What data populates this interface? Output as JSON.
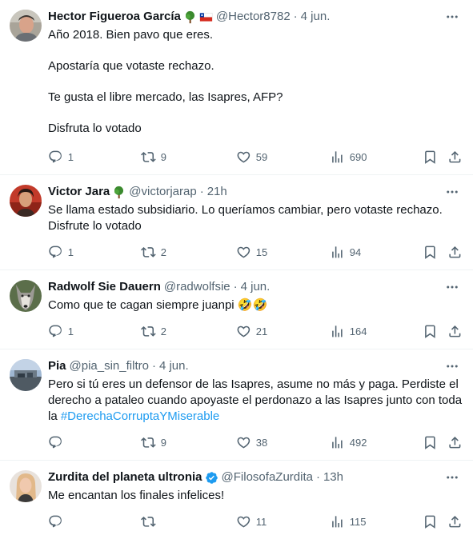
{
  "tweets": [
    {
      "name": "Hector Figueroa García",
      "handle": "@Hector8782",
      "time": "4 jun.",
      "paragraphs": [
        "Año 2018. Bien pavo que eres.",
        "Apostaría que votaste rechazo.",
        "Te gusta el libre mercado, las Isapres, AFP?",
        "Disfruta lo votado"
      ],
      "replies": "1",
      "reposts": "9",
      "likes": "59",
      "views": "690"
    },
    {
      "name": "Victor Jara",
      "handle": "@victorjarap",
      "time": "21h",
      "text": "Se llama estado subsidiario. Lo queríamos cambiar, pero votaste rechazo. Disfrute lo votado",
      "replies": "1",
      "reposts": "2",
      "likes": "15",
      "views": "94"
    },
    {
      "name": "Radwolf Sie Dauern",
      "handle": "@radwolfsie",
      "time": "4 jun.",
      "text": "Como que te cagan siempre juanpi 🤣🤣",
      "replies": "1",
      "reposts": "2",
      "likes": "21",
      "views": "164"
    },
    {
      "name": "Pia",
      "handle": "@pia_sin_filtro",
      "time": "4 jun.",
      "text": "Pero si tú eres un defensor de las Isapres, asume no más y paga. Perdiste el derecho a pataleo cuando apoyaste el perdonazo a las Isapres junto con toda la ",
      "hashtag": "#DerechaCorruptaYMiserable",
      "replies": "",
      "reposts": "9",
      "likes": "38",
      "views": "492"
    },
    {
      "name": "Zurdita del planeta ultronia",
      "handle": "@FilosofaZurdita",
      "time": "13h",
      "text": "Me encantan los finales infelices!",
      "replies": "",
      "reposts": "",
      "likes": "11",
      "views": "115"
    }
  ],
  "common": {
    "separator": "·"
  },
  "icons": {
    "reply": "reply-icon",
    "repost": "repost-icon",
    "like": "heart-icon",
    "views": "views-icon",
    "bookmark": "bookmark-icon",
    "share": "share-icon",
    "more": "more-icon",
    "tree": "tree-emoji",
    "flag": "chile-flag-emoji",
    "verified": "verified-badge-icon"
  },
  "colors": {
    "text": "#0f1419",
    "secondary": "#536471",
    "link": "#1d9bf0",
    "divider": "#eff3f4",
    "verified": "#1d9bf0"
  }
}
